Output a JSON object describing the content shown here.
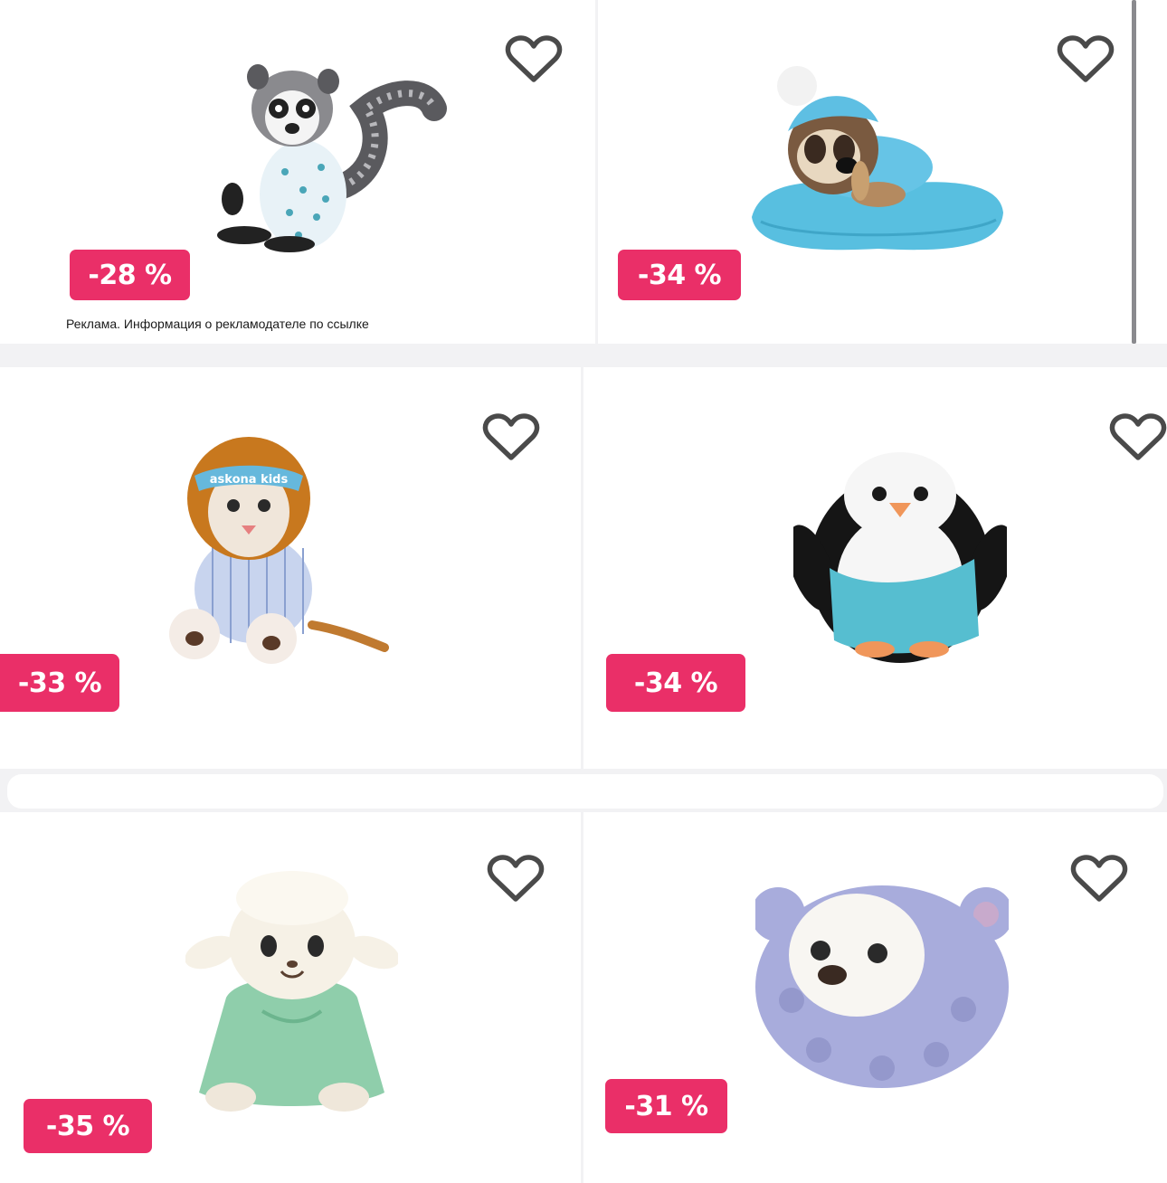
{
  "products": [
    {
      "name": "lemur",
      "discount": "-28 %",
      "ad_note": "Реклама. Информация о рекламодателе по ссылке",
      "favorite_icon": "heart-outline-icon"
    },
    {
      "name": "raccoon",
      "discount": "-34 %",
      "favorite_icon": "heart-outline-icon"
    },
    {
      "name": "lion",
      "discount": "-33 %",
      "favorite_icon": "heart-outline-icon",
      "mask_text": "askona kids"
    },
    {
      "name": "penguin",
      "discount": "-34 %",
      "favorite_icon": "heart-outline-icon"
    },
    {
      "name": "lamb",
      "discount": "-35 %",
      "favorite_icon": "heart-outline-icon"
    },
    {
      "name": "bear",
      "discount": "-31 %",
      "favorite_icon": "heart-outline-icon"
    }
  ],
  "colors": {
    "badge": "#ea2f68",
    "heart": "#4a4a4a",
    "background": "#f2f2f4"
  }
}
